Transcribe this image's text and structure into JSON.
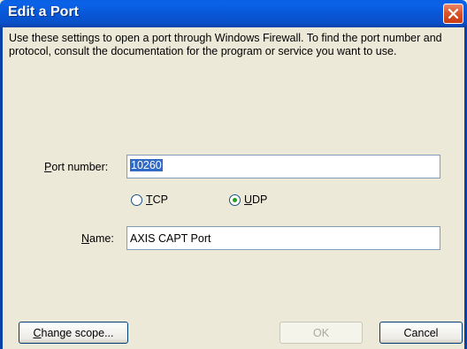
{
  "window": {
    "title": "Edit a Port"
  },
  "intro": {
    "text": "Use these settings to open a port through Windows Firewall. To find the port number and protocol, consult the documentation for the program or service you want to use."
  },
  "port": {
    "label_mnemonic": "P",
    "label_rest": "ort number:",
    "value": "10260"
  },
  "protocol": {
    "tcp_mnemonic": "T",
    "tcp_rest": "CP",
    "udp_mnemonic": "U",
    "udp_rest": "DP",
    "selected": "UDP"
  },
  "name": {
    "label_mnemonic": "N",
    "label_rest": "ame:",
    "value": "AXIS CAPT Port"
  },
  "buttons": {
    "change_scope_mnemonic": "C",
    "change_scope_rest": "hange scope...",
    "ok_label": "OK",
    "cancel_label": "Cancel"
  },
  "icons": {
    "close": "close-icon"
  },
  "colors": {
    "titlebar": "#0a57d8",
    "close_button": "#d9562c",
    "dialog_bg": "#ece9d8",
    "selection": "#316ac5",
    "radio_dot": "#21a121"
  }
}
